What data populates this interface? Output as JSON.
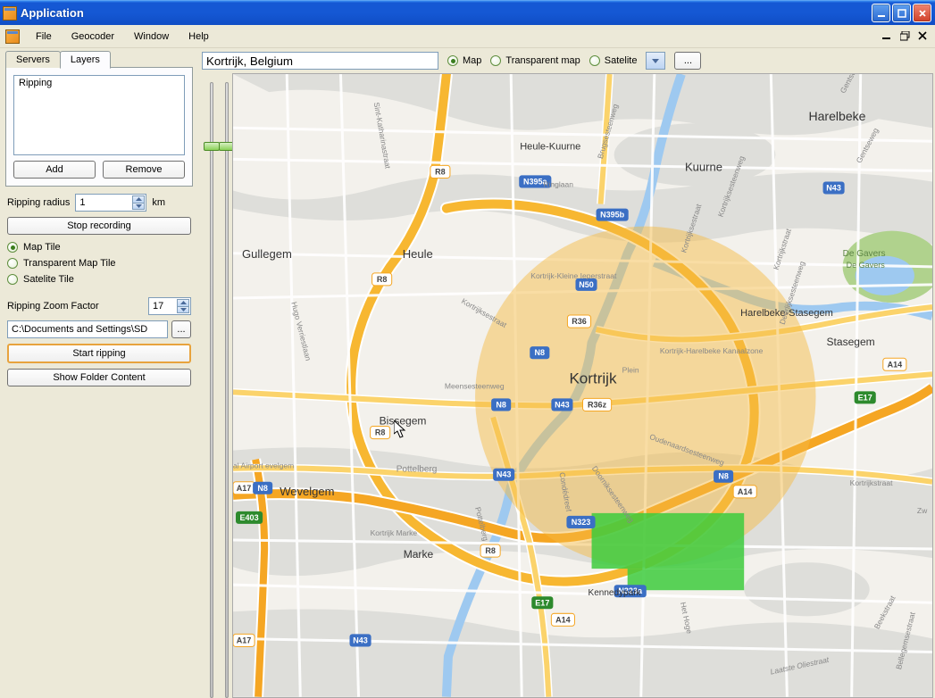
{
  "title": "Application",
  "menu": {
    "file": "File",
    "geocoder": "Geocoder",
    "window": "Window",
    "help": "Help"
  },
  "tabs": {
    "servers": "Servers",
    "layers": "Layers",
    "active": "layers"
  },
  "layers": {
    "items": [
      "Ripping"
    ],
    "add": "Add",
    "remove": "Remove"
  },
  "ripping": {
    "radius_label": "Ripping radius",
    "radius_value": "1",
    "radius_unit": "km",
    "stop_btn": "Stop recording",
    "tile_options": {
      "map": "Map Tile",
      "transparent": "Transparent Map Tile",
      "satelite": "Satelite Tile",
      "selected": "map"
    },
    "zoom_label": "Ripping Zoom Factor",
    "zoom_value": "17",
    "path": "C:\\Documents and Settings\\SD",
    "start_btn": "Start ripping",
    "folder_btn": "Show Folder Content"
  },
  "map_toolbar": {
    "search_value": "Kortrijk, Belgium",
    "options": {
      "map": "Map",
      "transparent": "Transparent map",
      "satelite": "Satelite",
      "selected": "map"
    },
    "more": "..."
  },
  "map": {
    "center_city": "Kortrijk",
    "cities": [
      "Harelbeke",
      "Kuurne",
      "Heule-Kuurne",
      "Heule",
      "Gullegem",
      "Bissegem",
      "Wevelgem",
      "Marke",
      "Pottelberg",
      "Harelbeke-Stasegem",
      "Stasegem",
      "Kennedypark"
    ],
    "parks": [
      "De Gavers",
      "De Gavers"
    ],
    "small_labels": [
      "Kortrijk-Kleine Ieperstraat",
      "Kortrijk-Harelbeke Kanaalzone",
      "Kortrijk Marke",
      "al Airport evelgem",
      "Gentsesteenweg",
      "Brugsesteenweg",
      "Kortrijksesteenweg",
      "Ringlaan",
      "Kortrijksestraat",
      "Kortrijkstraat",
      "Kortrijksestraat",
      "Kortrijkstraat",
      "Hugo Verriestlaan",
      "Meensesteenweg",
      "Oudenaardsesteenweg",
      "Condédreef",
      "Pottelberg",
      "Plein",
      "Doorniksesteenweg",
      "Sint-Katharinastraat",
      "Gentseweg",
      "Deerlijksesteenweg",
      "Zw",
      "Beekstraat",
      "Het Hoge",
      "Laatste Oliestraat",
      "Bellegemsestraat"
    ],
    "road_badges": [
      "R8",
      "N395a",
      "N395b",
      "R8",
      "N50",
      "R36",
      "N8",
      "R8",
      "R8",
      "N8",
      "N43",
      "N43",
      "R36z",
      "A14",
      "N8",
      "E17",
      "E17",
      "A14",
      "N323",
      "N323a",
      "N43",
      "A17",
      "E403",
      "R8",
      "R8",
      "N8",
      "N43",
      "A17"
    ]
  }
}
